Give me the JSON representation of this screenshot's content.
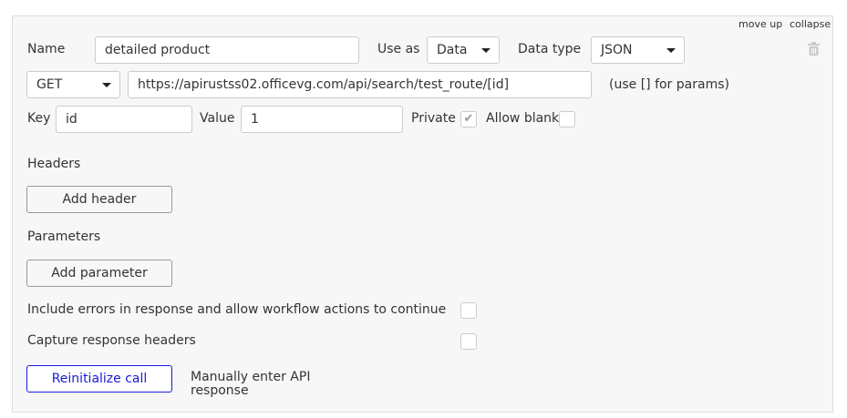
{
  "actions": {
    "move_up": "move up",
    "collapse": "collapse"
  },
  "name": {
    "label": "Name",
    "value": "detailed product"
  },
  "use_as": {
    "label": "Use as",
    "value": "Data"
  },
  "data_type": {
    "label": "Data type",
    "value": "JSON"
  },
  "method": "GET",
  "url": "https://apirustss02.officevg.com/api/search/test_route/[id]",
  "url_hint": "(use [] for params)",
  "param": {
    "key_label": "Key",
    "key": "id",
    "value_label": "Value",
    "value": "1",
    "private_label": "Private",
    "private": true,
    "allow_blank_label": "Allow blank",
    "allow_blank": false
  },
  "headers": {
    "title": "Headers",
    "add": "Add header"
  },
  "parameters": {
    "title": "Parameters",
    "add": "Add parameter"
  },
  "include_errors": {
    "label": "Include errors in response and allow workflow actions to continue",
    "checked": false
  },
  "capture_headers": {
    "label": "Capture response headers",
    "checked": false
  },
  "reinit": "Reinitialize call",
  "manual": "Manually enter API response"
}
